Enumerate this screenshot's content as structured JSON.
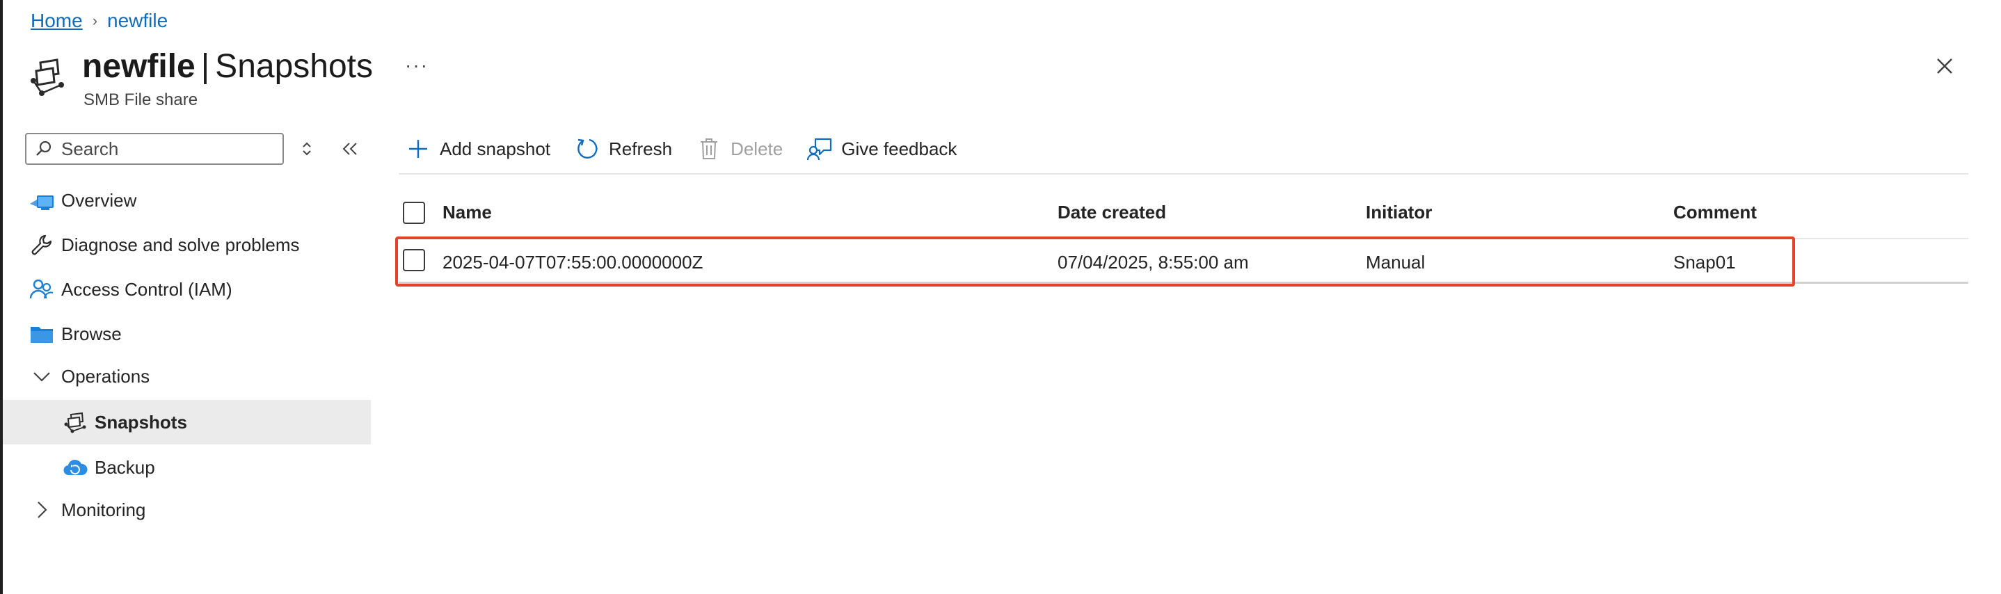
{
  "breadcrumb": {
    "items": [
      {
        "label": "Home",
        "link": true
      },
      {
        "label": "newfile",
        "link": false
      }
    ]
  },
  "header": {
    "name": "newfile",
    "separator": "|",
    "section": "Snapshots",
    "subtitle": "SMB File share",
    "more_label": "···"
  },
  "sidebar": {
    "search_placeholder": "Search",
    "items": [
      {
        "label": "Overview",
        "icon": "overview-icon"
      },
      {
        "label": "Diagnose and solve problems",
        "icon": "wrench-icon"
      },
      {
        "label": "Access Control (IAM)",
        "icon": "people-icon"
      },
      {
        "label": "Browse",
        "icon": "folder-icon"
      },
      {
        "label": "Operations",
        "icon": "chevron-down-icon",
        "expanded": true
      },
      {
        "label": "Snapshots",
        "icon": "snapshot-icon",
        "active": true
      },
      {
        "label": "Backup",
        "icon": "cloud-backup-icon"
      },
      {
        "label": "Monitoring",
        "icon": "chevron-right-icon",
        "expanded": false
      }
    ]
  },
  "toolbar": {
    "add_label": "Add snapshot",
    "refresh_label": "Refresh",
    "delete_label": "Delete",
    "feedback_label": "Give feedback"
  },
  "table": {
    "columns": [
      "Name",
      "Date created",
      "Initiator",
      "Comment"
    ],
    "rows": [
      {
        "name": "2025-04-07T07:55:00.0000000Z",
        "date_created": "07/04/2025, 8:55:00 am",
        "initiator": "Manual",
        "comment": "Snap01",
        "highlighted": true
      }
    ]
  },
  "colors": {
    "accent": "#0f6cbd",
    "highlight_border": "#e0442a",
    "selected_nav_bg": "#ebebeb",
    "disabled_text": "#a0a0a0"
  }
}
